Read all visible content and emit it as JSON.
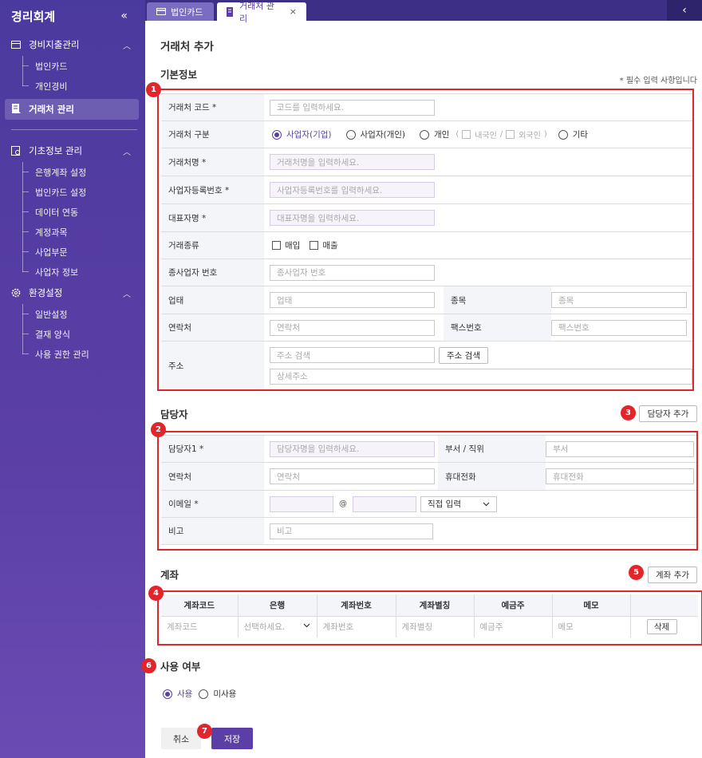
{
  "sidebar": {
    "title": "경리회계",
    "collapse_icon": "«",
    "groups": [
      {
        "label": "경비지출관리",
        "items": [
          "법인카드",
          "개인경비"
        ]
      },
      {
        "label": "기초정보 관리",
        "items": [
          "은행계좌 설정",
          "법인카드 설정",
          "데이터 연동",
          "계정과목",
          "사업부문",
          "사업자 정보"
        ]
      },
      {
        "label": "환경설정",
        "items": [
          "일반설정",
          "결재 양식",
          "사용 권한 관리"
        ]
      }
    ],
    "active_label": "거래처 관리"
  },
  "tabs": {
    "tab1": "법인카드",
    "tab2": "거래처 관리",
    "close": "×",
    "scroll": "‹"
  },
  "page": {
    "title": "거래처 추가",
    "required_note": "* 필수 입력 사항입니다"
  },
  "basic": {
    "title": "기본정보",
    "code_label": "거래처 코드 *",
    "code_ph": "코드를 입력하세요.",
    "type_label": "거래처 구분",
    "type_opts": [
      "사업자(기업)",
      "사업자(개인)",
      "개인",
      "기타"
    ],
    "sub_paren_open": "(",
    "sub_domestic": "내국인",
    "sub_slash": "/",
    "sub_foreign": "외국인",
    "sub_paren_close": ")",
    "name_label": "거래처명 *",
    "name_ph": "거래처명을 입력하세요.",
    "bizno_label": "사업자등록번호 *",
    "bizno_ph": "사업자등록번호를 입력하세요.",
    "ceo_label": "대표자명 *",
    "ceo_ph": "대표자명을 입력하세요.",
    "kind_label": "거래종류",
    "kind_opts": [
      "매입",
      "매출"
    ],
    "subbiz_label": "종사업자 번호",
    "subbiz_ph": "종사업자 번호",
    "biztype_label": "업태",
    "biztype_ph": "업태",
    "item_label": "종목",
    "item_ph": "종목",
    "phone_label": "연락처",
    "phone_ph": "연락처",
    "fax_label": "팩스번호",
    "fax_ph": "팩스번호",
    "addr_label": "주소",
    "addr_ph": "주소 검색",
    "addr_btn": "주소 검색",
    "addr2_ph": "상세주소"
  },
  "contact": {
    "title": "담당자",
    "add_btn": "담당자 추가",
    "name_label": "담당자1 *",
    "name_ph": "담당자명을 입력하세요.",
    "dept_label": "부서 / 직위",
    "dept_ph": "부서",
    "phone_label": "연락처",
    "phone_ph": "연락처",
    "mobile_label": "휴대전화",
    "mobile_ph": "휴대전화",
    "email_label": "이메일 *",
    "at": "@",
    "domain_select": "직접 입력",
    "memo_label": "비고",
    "memo_ph": "비고"
  },
  "account": {
    "title": "계좌",
    "add_btn": "계좌 추가",
    "headers": [
      "계좌코드",
      "은행",
      "계좌번호",
      "계좌별칭",
      "예금주",
      "메모",
      ""
    ],
    "row": {
      "code": "계좌코드",
      "bank": "선택하세요.",
      "number": "계좌번호",
      "alias": "계좌별칭",
      "holder": "예금주",
      "memo": "메모",
      "delete": "삭제"
    }
  },
  "usage": {
    "title": "사용 여부",
    "on": "사용",
    "off": "미사용"
  },
  "footer": {
    "cancel": "취소",
    "save": "저장"
  },
  "badges": [
    "1",
    "2",
    "3",
    "4",
    "5",
    "6",
    "7"
  ],
  "colors": {
    "accent": "#5b3fa6",
    "annotation": "#e0262b"
  }
}
